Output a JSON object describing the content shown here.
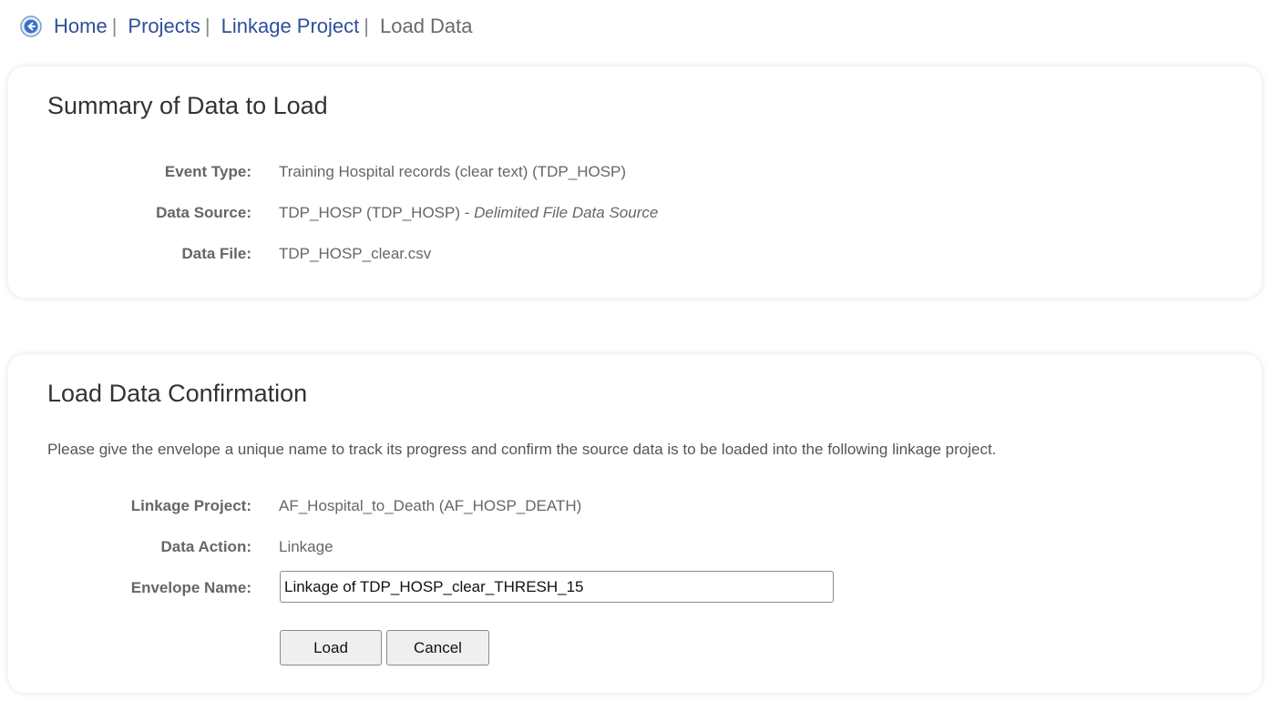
{
  "breadcrumb": {
    "back_icon": "back-arrow-circle-icon",
    "items": [
      {
        "label": "Home"
      },
      {
        "label": "Projects"
      },
      {
        "label": "Linkage Project"
      }
    ],
    "separator": "|",
    "current": "Load Data"
  },
  "summary": {
    "title": "Summary of Data to Load",
    "event_type": {
      "label": "Event Type:",
      "value": "Training Hospital records (clear text) (TDP_HOSP)"
    },
    "data_source": {
      "label": "Data Source:",
      "value": "TDP_HOSP (TDP_HOSP)",
      "separator": " - ",
      "type": "Delimited File Data Source"
    },
    "data_file": {
      "label": "Data File:",
      "value": "TDP_HOSP_clear.csv"
    }
  },
  "confirmation": {
    "title": "Load Data Confirmation",
    "intro": "Please give the envelope a unique name to track its progress and confirm the source data is to be loaded into the following linkage project.",
    "linkage_project": {
      "label": "Linkage Project:",
      "value": "AF_Hospital_to_Death (AF_HOSP_DEATH)"
    },
    "data_action": {
      "label": "Data Action:",
      "value": "Linkage"
    },
    "envelope_name": {
      "label": "Envelope Name:",
      "value": "Linkage of TDP_HOSP_clear_THRESH_15"
    },
    "load_label": "Load",
    "cancel_label": "Cancel"
  },
  "colors": {
    "link": "#2f4f9a",
    "icon_blue": "#3b6fc4"
  }
}
